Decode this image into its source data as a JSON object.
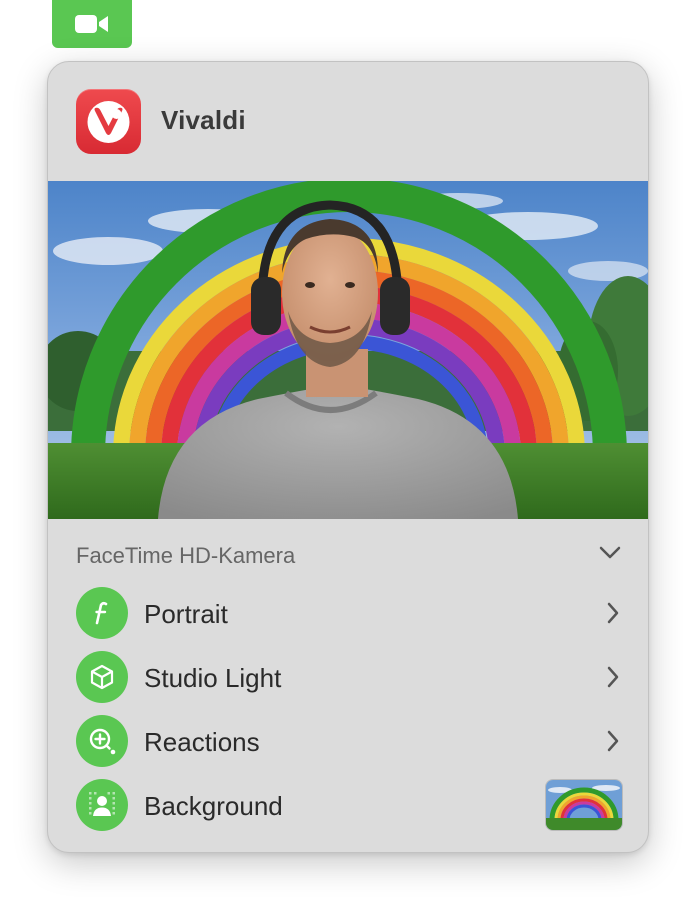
{
  "menubar": {
    "icon": "video-camera-icon",
    "color": "#5ac752"
  },
  "app": {
    "name": "Vivaldi",
    "icon": "vivaldi-logo-icon",
    "icon_color": "#e43b41"
  },
  "camera": {
    "selected": "FaceTime HD-Kamera",
    "dropdown_icon": "chevron-down-icon"
  },
  "effects": [
    {
      "label": "Portrait",
      "icon": "portrait-f-icon",
      "accessory": "chevron-right-icon"
    },
    {
      "label": "Studio Light",
      "icon": "cube-icon",
      "accessory": "chevron-right-icon"
    },
    {
      "label": "Reactions",
      "icon": "reactions-magnifier-icon",
      "accessory": "chevron-right-icon"
    },
    {
      "label": "Background",
      "icon": "person-background-icon",
      "accessory": "background-thumbnail"
    }
  ],
  "colors": {
    "accent_green": "#5ac752",
    "panel_bg": "#dcdcdc"
  }
}
